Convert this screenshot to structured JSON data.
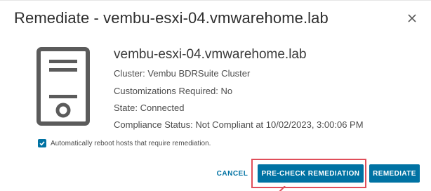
{
  "dialog": {
    "title": "Remediate - vembu-esxi-04.vmwarehome.lab",
    "close_icon": "close-icon"
  },
  "host": {
    "icon": "server-icon",
    "name": "vembu-esxi-04.vmwarehome.lab",
    "cluster": "Cluster: Vembu BDRSuite Cluster",
    "customizations": "Customizations Required: No",
    "state": "State: Connected",
    "compliance": "Compliance Status: Not Compliant at 10/02/2023, 3:00:06 PM"
  },
  "options": {
    "auto_reboot_label": "Automatically reboot hosts that require remediation.",
    "auto_reboot_checked": true
  },
  "footer": {
    "cancel_label": "CANCEL",
    "precheck_label": "PRE-CHECK REMEDIATION",
    "remediate_label": "REMEDIATE"
  },
  "colors": {
    "accent": "#0072a3",
    "highlight": "#e04e5a",
    "icon_gray": "#5b5b5b"
  }
}
